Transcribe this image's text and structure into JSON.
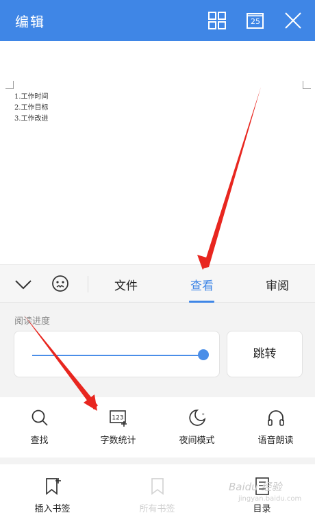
{
  "header": {
    "title": "编辑",
    "page_number": "25",
    "icons": [
      "grid-icon",
      "page-count-icon",
      "close-icon"
    ]
  },
  "document": {
    "lines": [
      "1.工作时间",
      "2.工作目标",
      "3.工作改进"
    ]
  },
  "tabbar": {
    "icons": [
      "chevron-down-icon",
      "emoji-icon"
    ],
    "tabs": [
      {
        "label": "文件",
        "active": false
      },
      {
        "label": "查看",
        "active": true
      },
      {
        "label": "审阅",
        "active": false
      }
    ]
  },
  "reading_progress": {
    "label": "阅读进度",
    "value_fraction": 1.0,
    "jump_label": "跳转"
  },
  "tools": [
    {
      "label": "查找",
      "icon": "search-icon"
    },
    {
      "label": "字数统计",
      "icon": "word-count-icon"
    },
    {
      "label": "夜间模式",
      "icon": "moon-icon"
    },
    {
      "label": "语音朗读",
      "icon": "headphones-icon"
    }
  ],
  "bottom_tools": [
    {
      "label": "插入书签",
      "icon": "add-bookmark-icon",
      "enabled": true
    },
    {
      "label": "所有书签",
      "icon": "bookmark-icon",
      "enabled": false
    },
    {
      "label": "目录",
      "icon": "contents-icon",
      "enabled": true
    }
  ],
  "watermark": {
    "text": "Baidu 经验",
    "sub": "jingyan.baidu.com"
  },
  "colors": {
    "accent": "#3f86e6",
    "annotation": "#e8261f"
  }
}
